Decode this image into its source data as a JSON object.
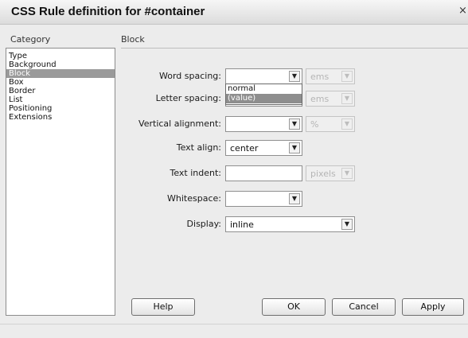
{
  "dialog": {
    "title": "CSS Rule definition for #container",
    "close_glyph": "×"
  },
  "category": {
    "label": "Category",
    "items": [
      "Type",
      "Background",
      "Block",
      "Box",
      "Border",
      "List",
      "Positioning",
      "Extensions"
    ],
    "selected": "Block"
  },
  "section": {
    "title": "Block"
  },
  "fields": {
    "word_spacing": {
      "label": "Word spacing:",
      "value": "",
      "unit": "ems"
    },
    "letter_spacing": {
      "label": "Letter spacing:",
      "value": "",
      "unit": "ems"
    },
    "vertical_alignment": {
      "label": "Vertical alignment:",
      "value": "",
      "unit": "%"
    },
    "text_align": {
      "label": "Text align:",
      "value": "center"
    },
    "text_indent": {
      "label": "Text indent:",
      "value": "",
      "unit": "pixels"
    },
    "whitespace": {
      "label": "Whitespace:",
      "value": ""
    },
    "display": {
      "label": "Display:",
      "value": "inline"
    }
  },
  "dropdown_open": {
    "options": [
      "normal",
      "(value)"
    ],
    "selected": "(value)"
  },
  "buttons": {
    "help": "Help",
    "ok": "OK",
    "cancel": "Cancel",
    "apply": "Apply"
  },
  "icons": {
    "dropdown_arrow": "chevron-down-icon",
    "close": "close-icon"
  },
  "colors": {
    "dialog_bg": "#ececec",
    "selection": "#9a9a9a"
  }
}
